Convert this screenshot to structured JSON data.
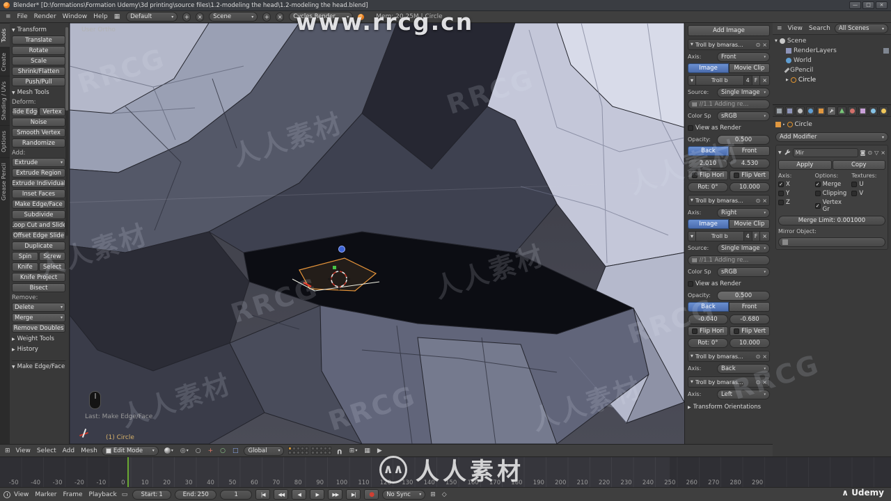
{
  "colors": {
    "accent_blue": "#4a71b4",
    "header_bg": "#3f3f3f",
    "panel_bg": "#3a3a3a",
    "current_frame_green": "#6aa832",
    "selected_orange": "#e8953a"
  },
  "titlebar": {
    "title": "Blender* [D:\\formations\\Formation Udemy\\3d printing\\source files\\1.2-modeling the head\\1.2-modeling the head.blend]"
  },
  "infobar": {
    "menus": [
      "File",
      "Render",
      "Window",
      "Help"
    ],
    "layout": "Default",
    "scene": "Scene",
    "engine": "Cycles Render",
    "stats": "Mem: 20.25M | Circle"
  },
  "toolshelf": {
    "tabs": [
      "Tools",
      "Create",
      "Shading / UVs",
      "Options",
      "Grease Pencil"
    ],
    "transform_title": "Transform",
    "transform_buttons": [
      "Translate",
      "Rotate",
      "Scale",
      "Shrink/Flatten",
      "Push/Pull"
    ],
    "meshtools_title": "Mesh Tools",
    "deform_label": "Deform:",
    "slide_edge": "Slide Edge",
    "slide_vertex": "Vertex",
    "deform_buttons": [
      "Noise",
      "Smooth Vertex",
      "Randomize"
    ],
    "add_label": "Add:",
    "extrude": "Extrude",
    "add_buttons": [
      "Extrude Region",
      "Extrude Individual",
      "Inset Faces",
      "Make Edge/Face",
      "Subdivide",
      "Loop Cut and Slide",
      "Offset Edge Slide",
      "Duplicate"
    ],
    "spin": "Spin",
    "screw": "Screw",
    "knife": "Knife",
    "select": "Select",
    "knife_project": "Knife Project",
    "bisect": "Bisect",
    "remove_label": "Remove:",
    "delete": "Delete",
    "merge": "Merge",
    "remove_doubles": "Remove Doubles",
    "weight_tools": "Weight Tools",
    "history": "History",
    "operator_panel": "Make Edge/Face"
  },
  "viewport": {
    "view_label": "User Ortho",
    "last_action": "Last: Make Edge/Face",
    "active_object": "(1) Circle"
  },
  "view3d_header": {
    "menus": [
      "View",
      "Select",
      "Add",
      "Mesh"
    ],
    "mode": "Edit Mode",
    "orientation": "Global"
  },
  "bg_panel": {
    "add_image": "Add Image",
    "axis_label": "Axis:",
    "source_label": "Source:",
    "colorspace_label": "Color Sp",
    "opacity_label": "Opacity:",
    "view_as_render": "View as Render",
    "tab_image": "Image",
    "tab_movie": "Movie Clip",
    "back": "Back",
    "front": "Front",
    "flip_h": "Flip Hori",
    "flip_v": "Flip Vert",
    "entries": [
      {
        "name": "Troll by bmaras...",
        "axis": "Front",
        "datablock": "Troll b",
        "users": "4",
        "fake": "F",
        "source": "Single Image",
        "path": "//1.1 Adding re...",
        "colorspace": "sRGB",
        "opacity": "0.500",
        "x": "2.010",
        "y": "4.530",
        "rot": "Rot: 0°",
        "size": "10.000"
      },
      {
        "name": "Troll by bmaras...",
        "axis": "Right",
        "datablock": "Troll b",
        "users": "4",
        "fake": "F",
        "source": "Single Image",
        "path": "//1.1 Adding re...",
        "colorspace": "sRGB",
        "opacity": "0.500",
        "x": "-0.040",
        "y": "-0.680",
        "rot": "Rot: 0°",
        "size": "10.000"
      },
      {
        "name": "Troll by bmaras...",
        "axis": "Back"
      },
      {
        "name": "Troll by bmaras...",
        "axis": "Left"
      }
    ],
    "transform_orientations": "Transform Orientations"
  },
  "outliner": {
    "menus": [
      "View",
      "Search"
    ],
    "display_mode": "All Scenes",
    "items": [
      {
        "label": "Scene"
      },
      {
        "label": "RenderLayers"
      },
      {
        "label": "World"
      },
      {
        "label": "GPencil"
      },
      {
        "label": "Circle"
      }
    ]
  },
  "properties": {
    "context_object": "Circle",
    "add_modifier": "Add Modifier",
    "modifier_name": "Mir",
    "apply": "Apply",
    "copy": "Copy",
    "axis_label": "Axis:",
    "options_label": "Options:",
    "textures_label": "Textures:",
    "axis_x": "X",
    "axis_y": "Y",
    "axis_z": "Z",
    "opt_merge": "Merge",
    "opt_clipping": "Clipping",
    "opt_vgroups": "Vertex Gr",
    "tex_u": "U",
    "tex_v": "V",
    "merge_limit": "Merge Limit: 0.001000",
    "mirror_object_label": "Mirror Object:"
  },
  "timeline": {
    "menus": [
      "View",
      "Marker",
      "Frame",
      "Playback"
    ],
    "start_label": "Start:",
    "start_value": "1",
    "end_label": "End:",
    "end_value": "250",
    "current_frame": "1",
    "sync_mode": "No Sync",
    "ruler_numbers": [
      "-50",
      "-40",
      "-30",
      "-20",
      "-10",
      "0",
      "10",
      "20",
      "30",
      "40",
      "50",
      "60",
      "70",
      "80",
      "90",
      "100",
      "110",
      "120",
      "130",
      "140",
      "150",
      "160",
      "170",
      "180",
      "190",
      "200",
      "210",
      "220",
      "230",
      "240",
      "250",
      "260",
      "270",
      "280",
      "290"
    ]
  },
  "icons": {
    "jump_start": "|◀",
    "prev_key": "◀◀",
    "play_rev": "◀",
    "play": "▶",
    "next_key": "▶▶",
    "jump_end": "▶|",
    "record": "●"
  },
  "watermarks": {
    "url": "www.rrcg.cn",
    "brand": "RRCG",
    "brand_cn": "人人素材",
    "udemy": "Udemy",
    "logo_glyph": "∧∧"
  }
}
